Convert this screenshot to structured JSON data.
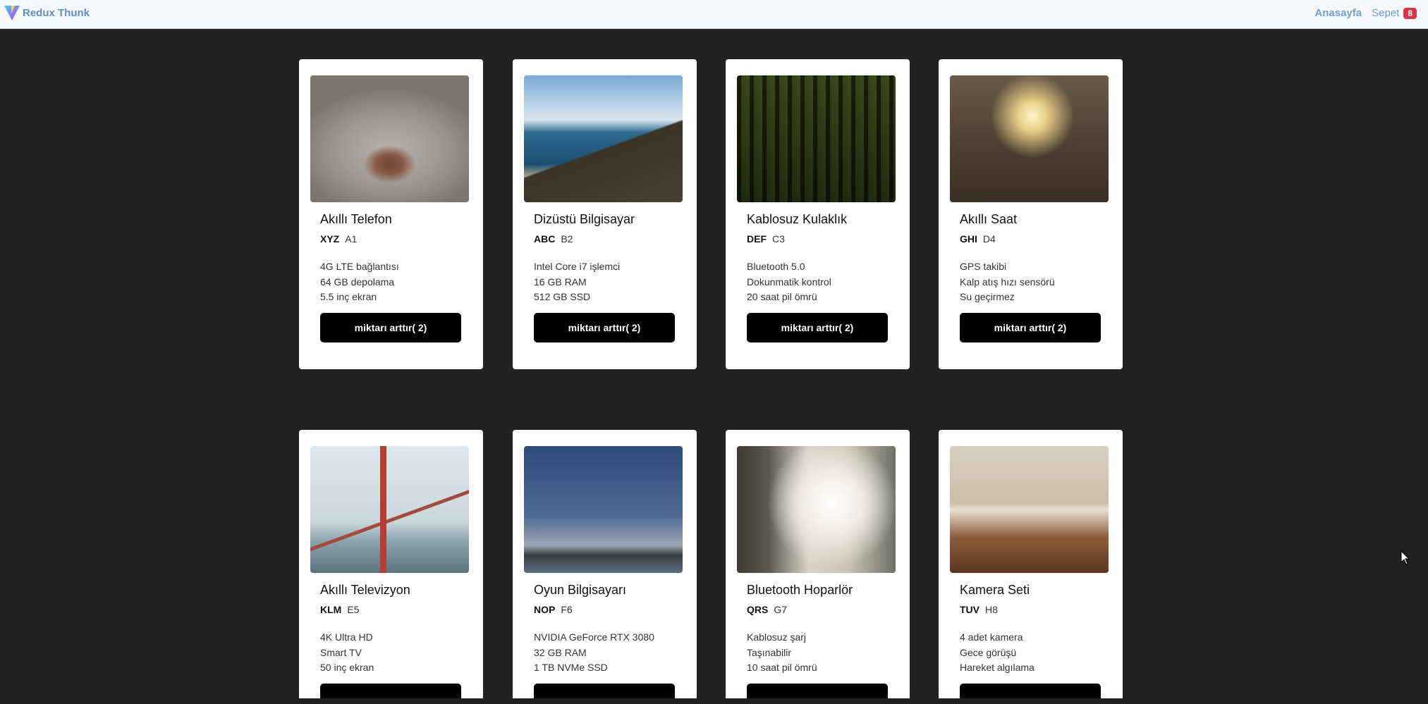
{
  "navbar": {
    "brand_label": "Redux Thunk",
    "home_label": "Anasayfa",
    "cart_label": "Sepet",
    "cart_count": "8"
  },
  "products": [
    {
      "name": "Akıllı Telefon",
      "brand": "XYZ",
      "model": "A1",
      "features": [
        "4G LTE bağlantısı",
        "64 GB depolama",
        "5.5 inç ekran"
      ],
      "button_label": "miktarı arttır( 2)",
      "image_icon": "cat-nose-photo"
    },
    {
      "name": "Dizüstü Bilgisayar",
      "brand": "ABC",
      "model": "B2",
      "features": [
        "Intel Core i7 işlemci",
        "16 GB RAM",
        "512 GB SSD"
      ],
      "button_label": "miktarı arttır( 2)",
      "image_icon": "beach-coast-photo"
    },
    {
      "name": "Kablosuz Kulaklık",
      "brand": "DEF",
      "model": "C3",
      "features": [
        "Bluetooth 5.0",
        "Dokunmatik kontrol",
        "20 saat pil ömrü"
      ],
      "button_label": "miktarı arttır( 2)",
      "image_icon": "forest-path-photo"
    },
    {
      "name": "Akıllı Saat",
      "brand": "GHI",
      "model": "D4",
      "features": [
        "GPS takibi",
        "Kalp atış hızı sensörü",
        "Su geçirmez"
      ],
      "button_label": "miktarı arttır( 2)",
      "image_icon": "sunset-grass-photo"
    },
    {
      "name": "Akıllı Televizyon",
      "brand": "KLM",
      "model": "E5",
      "features": [
        "4K Ultra HD",
        "Smart TV",
        "50 inç ekran"
      ],
      "button_label": "",
      "image_icon": "golden-gate-bridge-photo"
    },
    {
      "name": "Oyun Bilgisayarı",
      "brand": "NOP",
      "model": "F6",
      "features": [
        "NVIDIA GeForce RTX 3080",
        "32 GB RAM",
        "1 TB NVMe SSD"
      ],
      "button_label": "",
      "image_icon": "city-skyline-photo"
    },
    {
      "name": "Bluetooth Hoparlör",
      "brand": "QRS",
      "model": "G7",
      "features": [
        "Kablosuz şarj",
        "Taşınabilir",
        "10 saat pil ömrü"
      ],
      "button_label": "",
      "image_icon": "man-in-sunlight-photo"
    },
    {
      "name": "Kamera Seti",
      "brand": "TUV",
      "model": "H8",
      "features": [
        "4 adet kamera",
        "Gece görüşü",
        "Hareket algılama"
      ],
      "button_label": "",
      "image_icon": "open-book-photo"
    }
  ],
  "colors": {
    "page_background": "#222222",
    "navbar_background": "#f8f9fa",
    "link": "#6ea0d6",
    "badge": "#dc3545",
    "button": "#000000"
  }
}
